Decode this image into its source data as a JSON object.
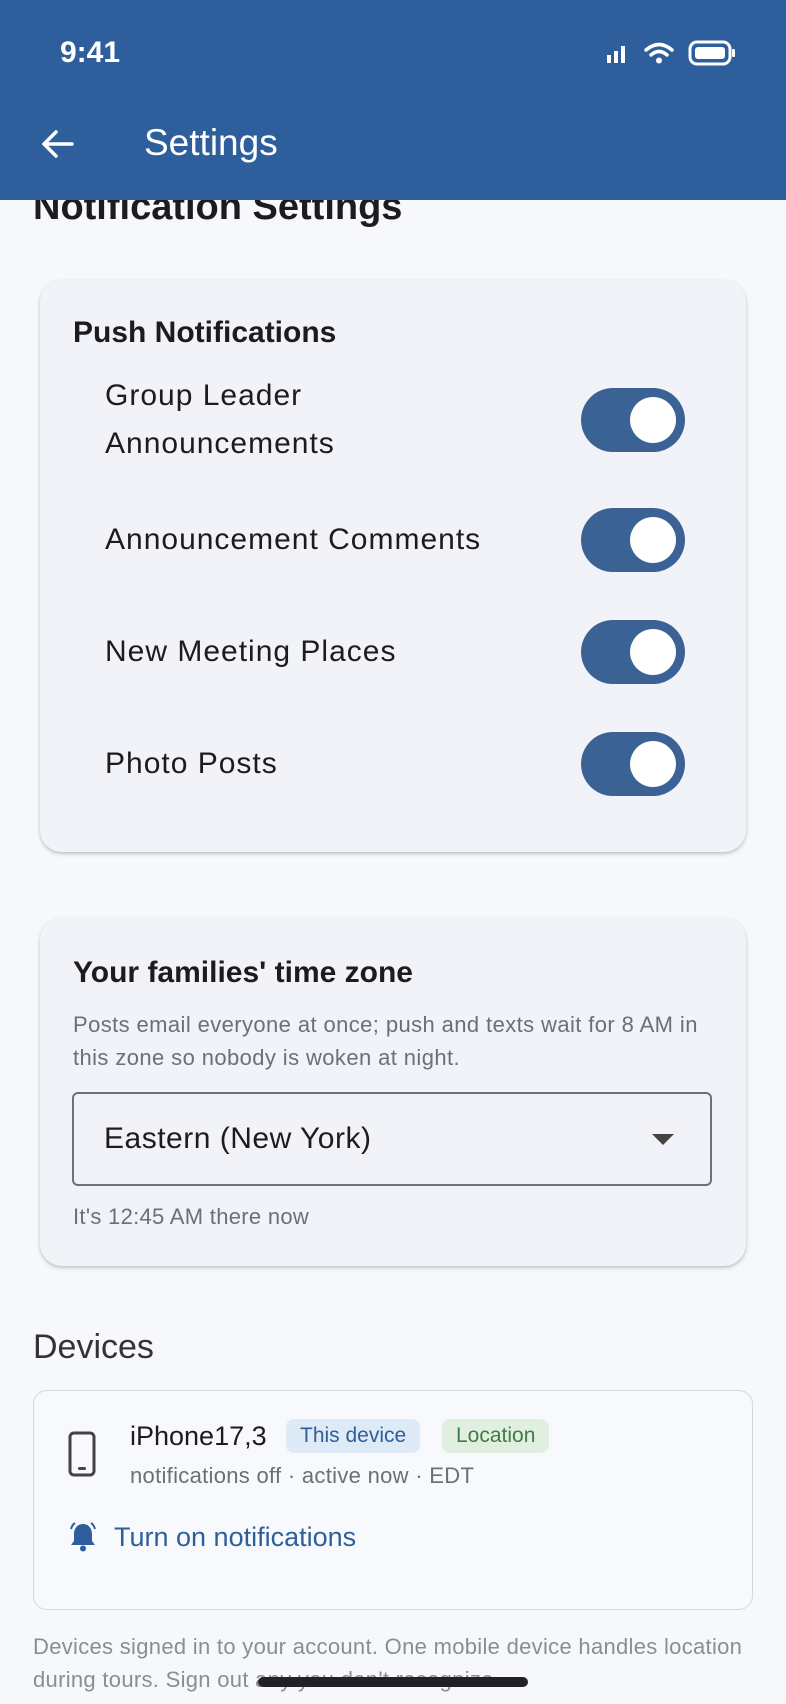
{
  "status_bar": {
    "time": "9:41"
  },
  "app_bar": {
    "title": "Settings"
  },
  "notification_section": {
    "title": "Notification Settings"
  },
  "push_notifications": {
    "heading": "Push Notifications",
    "items": [
      {
        "label": "Group Leader Announcements",
        "enabled": true
      },
      {
        "label": "Announcement Comments",
        "enabled": true
      },
      {
        "label": "New Meeting Places",
        "enabled": true
      },
      {
        "label": "Photo Posts",
        "enabled": true
      }
    ]
  },
  "time_zone": {
    "heading": "Your families' time zone",
    "description": "Posts email everyone at once; push and texts wait for 8 AM in this zone so nobody is woken at night.",
    "selected": "Eastern (New York)",
    "current_time_note": "It's 12:45 AM there now"
  },
  "devices": {
    "title": "Devices",
    "device": {
      "name": "iPhone17,3",
      "badge_this": "This device",
      "badge_location": "Location",
      "meta": "notifications off · active now · EDT",
      "action": "Turn on notifications"
    },
    "footnote": "Devices signed in to your account. One mobile device handles location during tours. Sign out any you don't recognize."
  },
  "colors": {
    "app_bar": "#2e5f9c",
    "toggle_on": "#3b6294",
    "link": "#2e5f9c"
  }
}
